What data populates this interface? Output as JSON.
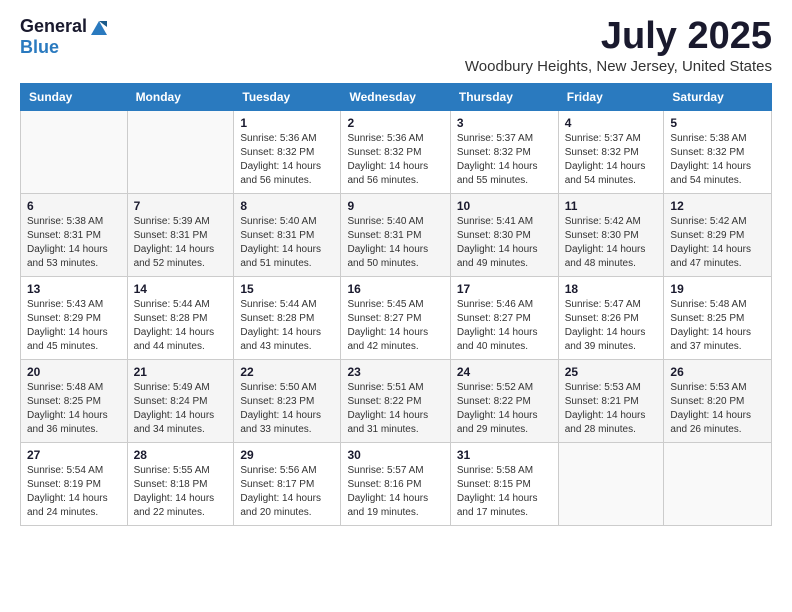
{
  "header": {
    "logo_general": "General",
    "logo_blue": "Blue",
    "month_title": "July 2025",
    "location": "Woodbury Heights, New Jersey, United States"
  },
  "calendar": {
    "days_of_week": [
      "Sunday",
      "Monday",
      "Tuesday",
      "Wednesday",
      "Thursday",
      "Friday",
      "Saturday"
    ],
    "weeks": [
      [
        {
          "day": "",
          "info": ""
        },
        {
          "day": "",
          "info": ""
        },
        {
          "day": "1",
          "info": "Sunrise: 5:36 AM\nSunset: 8:32 PM\nDaylight: 14 hours and 56 minutes."
        },
        {
          "day": "2",
          "info": "Sunrise: 5:36 AM\nSunset: 8:32 PM\nDaylight: 14 hours and 56 minutes."
        },
        {
          "day": "3",
          "info": "Sunrise: 5:37 AM\nSunset: 8:32 PM\nDaylight: 14 hours and 55 minutes."
        },
        {
          "day": "4",
          "info": "Sunrise: 5:37 AM\nSunset: 8:32 PM\nDaylight: 14 hours and 54 minutes."
        },
        {
          "day": "5",
          "info": "Sunrise: 5:38 AM\nSunset: 8:32 PM\nDaylight: 14 hours and 54 minutes."
        }
      ],
      [
        {
          "day": "6",
          "info": "Sunrise: 5:38 AM\nSunset: 8:31 PM\nDaylight: 14 hours and 53 minutes."
        },
        {
          "day": "7",
          "info": "Sunrise: 5:39 AM\nSunset: 8:31 PM\nDaylight: 14 hours and 52 minutes."
        },
        {
          "day": "8",
          "info": "Sunrise: 5:40 AM\nSunset: 8:31 PM\nDaylight: 14 hours and 51 minutes."
        },
        {
          "day": "9",
          "info": "Sunrise: 5:40 AM\nSunset: 8:31 PM\nDaylight: 14 hours and 50 minutes."
        },
        {
          "day": "10",
          "info": "Sunrise: 5:41 AM\nSunset: 8:30 PM\nDaylight: 14 hours and 49 minutes."
        },
        {
          "day": "11",
          "info": "Sunrise: 5:42 AM\nSunset: 8:30 PM\nDaylight: 14 hours and 48 minutes."
        },
        {
          "day": "12",
          "info": "Sunrise: 5:42 AM\nSunset: 8:29 PM\nDaylight: 14 hours and 47 minutes."
        }
      ],
      [
        {
          "day": "13",
          "info": "Sunrise: 5:43 AM\nSunset: 8:29 PM\nDaylight: 14 hours and 45 minutes."
        },
        {
          "day": "14",
          "info": "Sunrise: 5:44 AM\nSunset: 8:28 PM\nDaylight: 14 hours and 44 minutes."
        },
        {
          "day": "15",
          "info": "Sunrise: 5:44 AM\nSunset: 8:28 PM\nDaylight: 14 hours and 43 minutes."
        },
        {
          "day": "16",
          "info": "Sunrise: 5:45 AM\nSunset: 8:27 PM\nDaylight: 14 hours and 42 minutes."
        },
        {
          "day": "17",
          "info": "Sunrise: 5:46 AM\nSunset: 8:27 PM\nDaylight: 14 hours and 40 minutes."
        },
        {
          "day": "18",
          "info": "Sunrise: 5:47 AM\nSunset: 8:26 PM\nDaylight: 14 hours and 39 minutes."
        },
        {
          "day": "19",
          "info": "Sunrise: 5:48 AM\nSunset: 8:25 PM\nDaylight: 14 hours and 37 minutes."
        }
      ],
      [
        {
          "day": "20",
          "info": "Sunrise: 5:48 AM\nSunset: 8:25 PM\nDaylight: 14 hours and 36 minutes."
        },
        {
          "day": "21",
          "info": "Sunrise: 5:49 AM\nSunset: 8:24 PM\nDaylight: 14 hours and 34 minutes."
        },
        {
          "day": "22",
          "info": "Sunrise: 5:50 AM\nSunset: 8:23 PM\nDaylight: 14 hours and 33 minutes."
        },
        {
          "day": "23",
          "info": "Sunrise: 5:51 AM\nSunset: 8:22 PM\nDaylight: 14 hours and 31 minutes."
        },
        {
          "day": "24",
          "info": "Sunrise: 5:52 AM\nSunset: 8:22 PM\nDaylight: 14 hours and 29 minutes."
        },
        {
          "day": "25",
          "info": "Sunrise: 5:53 AM\nSunset: 8:21 PM\nDaylight: 14 hours and 28 minutes."
        },
        {
          "day": "26",
          "info": "Sunrise: 5:53 AM\nSunset: 8:20 PM\nDaylight: 14 hours and 26 minutes."
        }
      ],
      [
        {
          "day": "27",
          "info": "Sunrise: 5:54 AM\nSunset: 8:19 PM\nDaylight: 14 hours and 24 minutes."
        },
        {
          "day": "28",
          "info": "Sunrise: 5:55 AM\nSunset: 8:18 PM\nDaylight: 14 hours and 22 minutes."
        },
        {
          "day": "29",
          "info": "Sunrise: 5:56 AM\nSunset: 8:17 PM\nDaylight: 14 hours and 20 minutes."
        },
        {
          "day": "30",
          "info": "Sunrise: 5:57 AM\nSunset: 8:16 PM\nDaylight: 14 hours and 19 minutes."
        },
        {
          "day": "31",
          "info": "Sunrise: 5:58 AM\nSunset: 8:15 PM\nDaylight: 14 hours and 17 minutes."
        },
        {
          "day": "",
          "info": ""
        },
        {
          "day": "",
          "info": ""
        }
      ]
    ]
  }
}
